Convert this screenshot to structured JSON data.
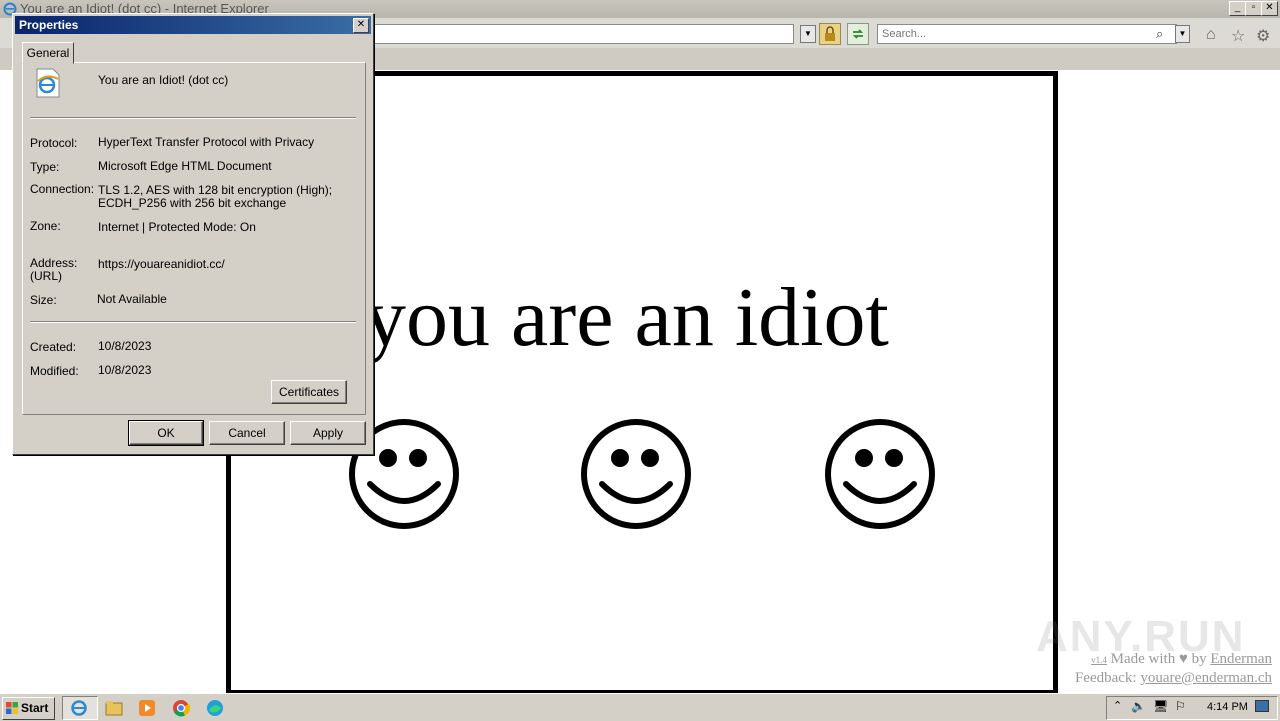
{
  "browser": {
    "title": "You are an Idiot! (dot cc) - Internet Explorer",
    "search_placeholder": "Search...",
    "colors": {
      "chrome": "#dcdad5",
      "titlebar": "#c8c5bd"
    }
  },
  "page": {
    "headline": "you are an idiot",
    "smiley_count": 3,
    "credit": {
      "version": "v1.4",
      "made_with": "Made with",
      "heart_icon": "heart-icon",
      "by": "by",
      "author": "Enderman",
      "feedback_label": "Feedback:",
      "feedback_email": "youare@enderman.ch"
    },
    "watermark": "ANY.RUN"
  },
  "dialog": {
    "title": "Properties",
    "tab": "General",
    "file_name": "You are an Idiot! (dot cc)",
    "rows": {
      "protocol": {
        "label": "Protocol:",
        "value": "HyperText Transfer Protocol with Privacy"
      },
      "type": {
        "label": "Type:",
        "value": "Microsoft Edge HTML Document"
      },
      "connection": {
        "label": "Connection:",
        "value_line1": "TLS 1.2, AES with 128 bit encryption (High);",
        "value_line2": "ECDH_P256 with 256 bit exchange"
      },
      "zone": {
        "label": "Zone:",
        "value": "Internet | Protected Mode: On"
      },
      "address": {
        "label_line1": "Address:",
        "label_line2": "(URL)",
        "value": "https://youareanidiot.cc/"
      },
      "size": {
        "label": "Size:",
        "value": "Not Available"
      },
      "created": {
        "label": "Created:",
        "value": "10/8/2023"
      },
      "modified": {
        "label": "Modified:",
        "value": "10/8/2023"
      }
    },
    "buttons": {
      "certificates": "Certificates",
      "ok": "OK",
      "cancel": "Cancel",
      "apply": "Apply"
    },
    "colors": {
      "face": "#d4d0c8",
      "title_start": "#0a246a",
      "title_end": "#3a6ea5"
    }
  },
  "taskbar": {
    "start_label": "Start",
    "clock": "4:14 PM",
    "apps": [
      "ie-icon",
      "explorer-icon",
      "media-player-icon",
      "chrome-icon",
      "edge-icon"
    ]
  }
}
